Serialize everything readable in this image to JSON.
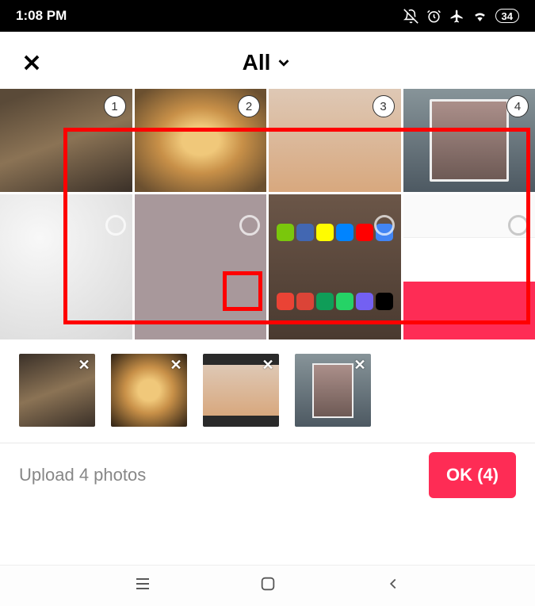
{
  "status_bar": {
    "time": "1:08 PM",
    "battery": "34"
  },
  "header": {
    "title": "All"
  },
  "grid": {
    "selected_badges": [
      1,
      2,
      3,
      4
    ]
  },
  "tray": {
    "items": [
      {
        "id": "thumb-1"
      },
      {
        "id": "thumb-2"
      },
      {
        "id": "thumb-3"
      },
      {
        "id": "thumb-4"
      }
    ]
  },
  "footer": {
    "upload_text": "Upload 4 photos",
    "ok_label": "OK (4)"
  }
}
